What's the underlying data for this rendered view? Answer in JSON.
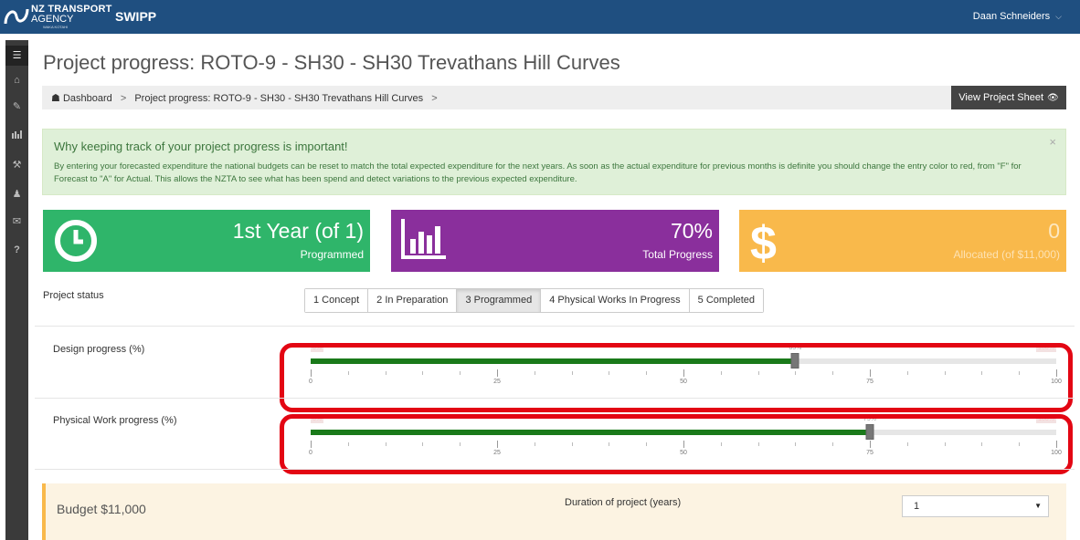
{
  "topbar": {
    "logo_line1": "NZ TRANSPORT",
    "logo_line2": "AGENCY",
    "logo_line3": "WAKA KOTAHI",
    "app_name": "SWIPP",
    "user_name": "Daan Schneiders",
    "user_chevron": "⌵"
  },
  "page": {
    "title": "Project progress: ROTO-9 - SH30 - SH30 Trevathans Hill Curves"
  },
  "breadcrumb": {
    "home": "Dashboard",
    "current": "Project progress: ROTO-9 - SH30 - SH30 Trevathans Hill Curves",
    "separator": ">"
  },
  "view_sheet_button": "View Project Sheet",
  "alert": {
    "heading": "Why keeping track of your project progress is important!",
    "body": "By entering your forecasted expenditure the national budgets can be reset to match the total expected expenditure for the next years. As soon as the actual expenditure for previous months is definite you should change the entry color to red, from \"F\" for Forecast to \"A\" for Actual. This allows the NZTA to see what has been spend and detect variations to the previous expected expenditure.",
    "close": "×"
  },
  "tiles": [
    {
      "big": "1st Year (of 1)",
      "small": "Programmed",
      "icon": "clock-icon",
      "color": "#2fb56a"
    },
    {
      "big": "70%",
      "small": "Total Progress",
      "icon": "bar-chart-icon",
      "color": "#8a2f9c"
    },
    {
      "big": "0",
      "small": "Allocated (of $11,000)",
      "icon": "dollar-icon",
      "color": "#f9b94b"
    }
  ],
  "project_status": {
    "label": "Project status",
    "options": [
      "1 Concept",
      "2 In Preparation",
      "3 Programmed",
      "4 Physical Works In Progress",
      "5 Completed"
    ],
    "selected": "3 Programmed"
  },
  "design_progress": {
    "label": "Design progress (%)",
    "value": 65,
    "value_label": "65%",
    "min_label": "0%",
    "max_label": "100%",
    "tick_labels": [
      "0",
      "25",
      "50",
      "75",
      "100"
    ]
  },
  "physical_progress": {
    "label": "Physical Work progress (%)",
    "value": 75,
    "value_label": "75%",
    "min_label": "0%",
    "max_label": "100%",
    "tick_labels": [
      "0",
      "25",
      "50",
      "75",
      "100"
    ]
  },
  "budget": {
    "title": "Budget $11,000",
    "duration_label": "Duration of project (years)",
    "duration_value": "1"
  },
  "colors": {
    "topbar": "#1f4f80",
    "slider_fill": "#1a7a1a",
    "highlight": "#e30613"
  }
}
